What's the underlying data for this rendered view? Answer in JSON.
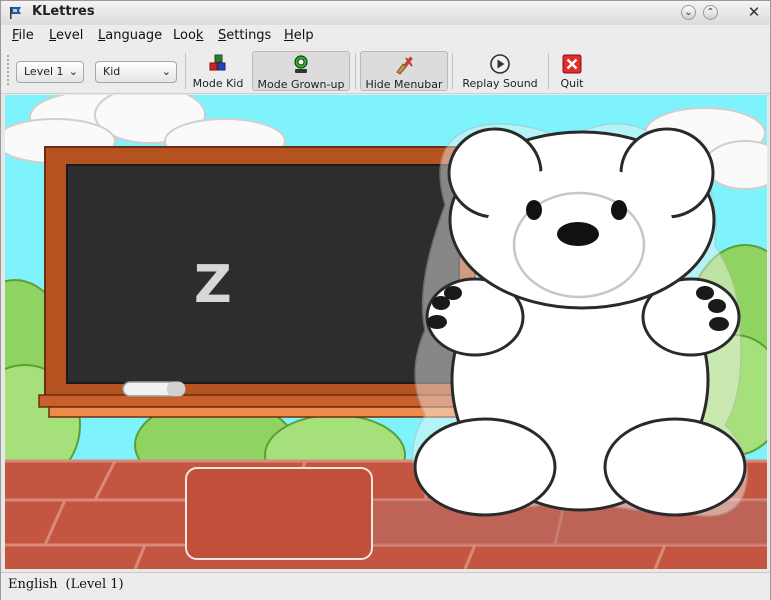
{
  "window": {
    "title": "KLettres",
    "controls": {
      "minimize": "⌄",
      "maximize": "⌃",
      "close": "✕"
    }
  },
  "menubar": {
    "items": [
      {
        "label": "File",
        "mnemonic": "F",
        "rest": "ile"
      },
      {
        "label": "Level",
        "mnemonic": "L",
        "pre": "",
        "rest": "evel"
      },
      {
        "label": "Language",
        "mnemonic": "L",
        "rest": "anguage"
      },
      {
        "label": "Look",
        "mnemonic": "k",
        "pre": "Loo",
        "rest": ""
      },
      {
        "label": "Settings",
        "mnemonic": "S",
        "rest": "ettings"
      },
      {
        "label": "Help",
        "mnemonic": "H",
        "rest": "elp"
      }
    ]
  },
  "toolbar": {
    "level_combo": "Level 1",
    "look_combo": "Kid",
    "mode_kid": "Mode Kid",
    "mode_grownup": "Mode Grown-up",
    "hide_menubar": "Hide Menubar",
    "replay_sound": "Replay Sound",
    "quit": "Quit"
  },
  "scene": {
    "letter": "Z",
    "answer": ""
  },
  "status": {
    "language": "English",
    "level": "(Level 1)"
  },
  "colors": {
    "sky": "#7ff3fb",
    "blackboard": "#2d2d2d",
    "board_frame": "#b4531f",
    "bricks": "#c45540",
    "grass": "#8fd462",
    "bear": "#ffffff"
  }
}
